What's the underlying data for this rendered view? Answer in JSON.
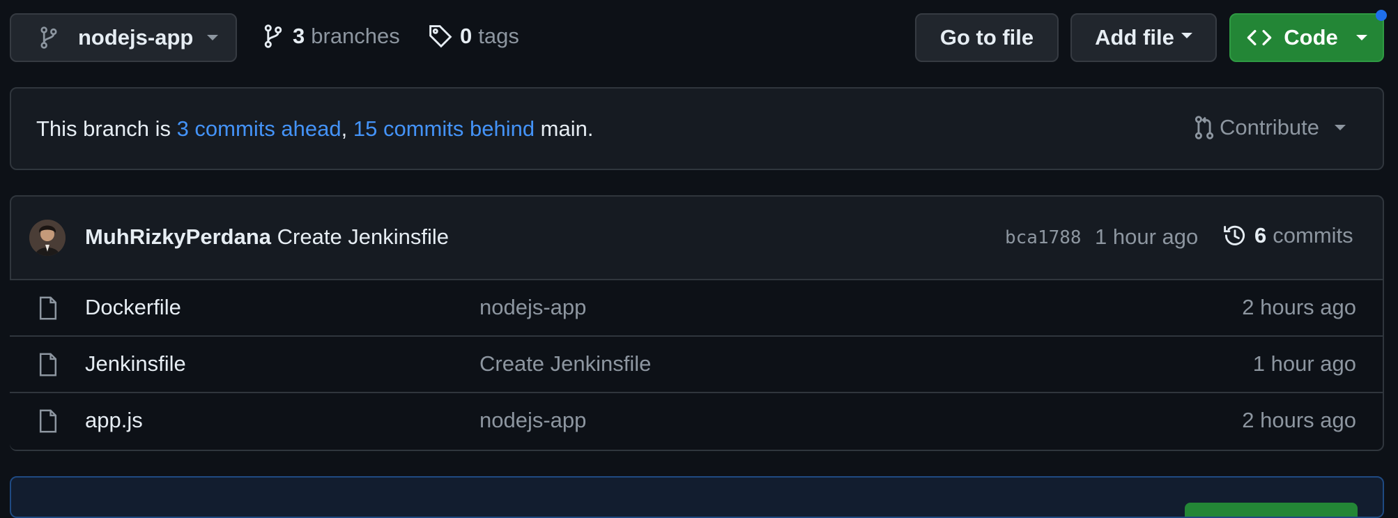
{
  "toolbar": {
    "branch_name": "nodejs-app",
    "branches_count": "3",
    "branches_label": "branches",
    "tags_count": "0",
    "tags_label": "tags",
    "go_to_file": "Go to file",
    "add_file": "Add file",
    "code": "Code"
  },
  "branch_status": {
    "prefix": "This branch is ",
    "ahead": "3 commits ahead",
    "separator": ", ",
    "behind": "15 commits behind",
    "suffix": " main.",
    "contribute": "Contribute"
  },
  "latest_commit": {
    "author": "MuhRizkyPerdana",
    "message": "Create Jenkinsfile",
    "sha": "bca1788",
    "time": "1 hour ago",
    "commits_count": "6",
    "commits_label": "commits"
  },
  "files": [
    {
      "name": "Dockerfile",
      "message": "nodejs-app",
      "time": "2 hours ago"
    },
    {
      "name": "Jenkinsfile",
      "message": "Create Jenkinsfile",
      "time": "1 hour ago"
    },
    {
      "name": "app.js",
      "message": "nodejs-app",
      "time": "2 hours ago"
    }
  ],
  "colors": {
    "background": "#0d1117",
    "link": "#4493f8",
    "code_button": "#238636",
    "notification_dot": "#1f6feb"
  }
}
